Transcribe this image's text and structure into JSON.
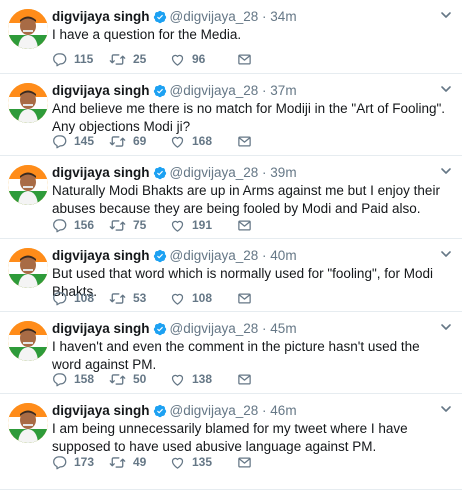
{
  "tweets": [
    {
      "name": "digvijaya singh",
      "handle": "@digvijaya_28",
      "time": "34m",
      "text": "I have a question for the Media.",
      "replies": "115",
      "retweets": "25",
      "likes": "96"
    },
    {
      "name": "digvijaya singh",
      "handle": "@digvijaya_28",
      "time": "37m",
      "text": "And believe me there is no match for Modiji in the \"Art of Fooling\". Any objections Modi ji?",
      "replies": "145",
      "retweets": "69",
      "likes": "168"
    },
    {
      "name": "digvijaya singh",
      "handle": "@digvijaya_28",
      "time": "39m",
      "text": "Naturally Modi Bhakts are up in Arms against me but I enjoy their abuses because they are being fooled by Modi and Paid also.",
      "replies": "156",
      "retweets": "75",
      "likes": "191"
    },
    {
      "name": "digvijaya singh",
      "handle": "@digvijaya_28",
      "time": "40m",
      "text": "But used that word which is normally used for \"fooling\", for Modi Bhakts.",
      "replies": "108",
      "retweets": "53",
      "likes": "108"
    },
    {
      "name": "digvijaya singh",
      "handle": "@digvijaya_28",
      "time": "45m",
      "text": "I haven't and even the comment in the picture hasn't used the word against PM.",
      "replies": "158",
      "retweets": "50",
      "likes": "138"
    },
    {
      "name": "digvijaya singh",
      "handle": "@digvijaya_28",
      "time": "46m",
      "text": "I am being unnecessarily blamed for my tweet where I have supposed to have used abusive language against PM.",
      "replies": "173",
      "retweets": "49",
      "likes": "135"
    }
  ],
  "separator": "·",
  "colors": {
    "text": "#14171a",
    "secondary": "#657786",
    "verified": "#1da1f2",
    "divider": "#e6ecf0"
  },
  "icons": {
    "verified": "verified-badge-icon",
    "caret": "chevron-down-icon",
    "reply": "reply-icon",
    "retweet": "retweet-icon",
    "like": "heart-icon",
    "message": "envelope-icon"
  }
}
